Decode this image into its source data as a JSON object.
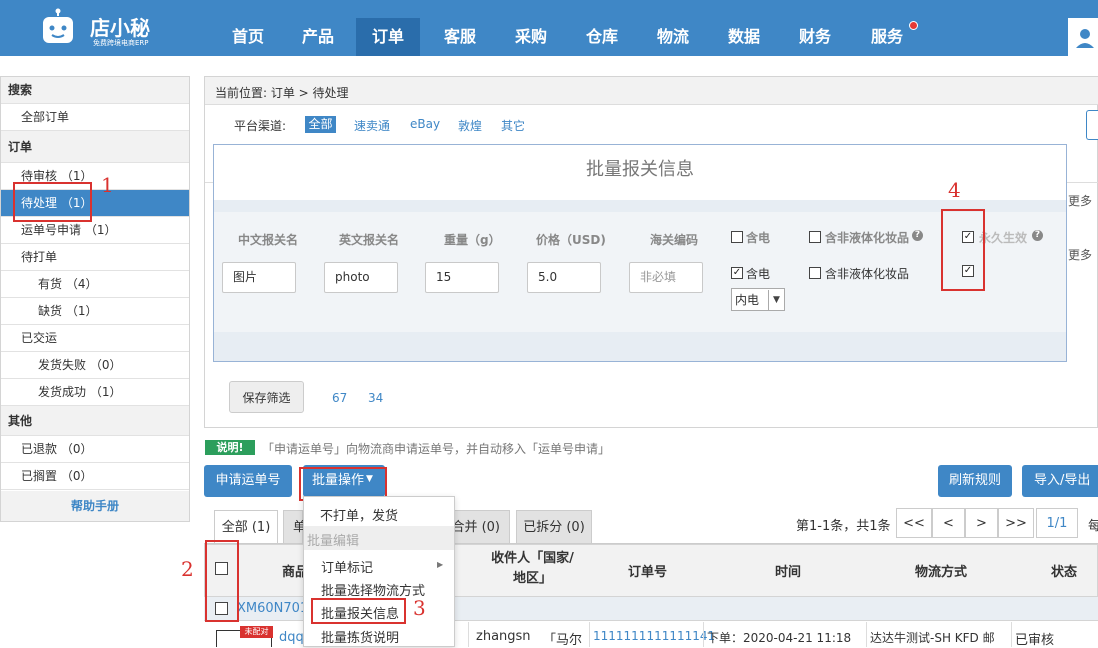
{
  "brand": {
    "name": "店小秘",
    "tagline": "免费跨境电商ERP"
  },
  "nav": [
    "首页",
    "产品",
    "订单",
    "客服",
    "采购",
    "仓库",
    "物流",
    "数据",
    "财务",
    "服务"
  ],
  "sidebar": {
    "search_head": "搜索",
    "all_orders": "全部订单",
    "order_head": "订单",
    "pending_review": "待审核 （1）",
    "to_process": "待处理 （1）",
    "waybill_apply": "运单号申请 （1）",
    "to_print": "待打单",
    "in_stock": "有货 （4）",
    "out_of_stock": "缺货 （1）",
    "shipped": "已交运",
    "ship_failed": "发货失败 （0）",
    "ship_success": "发货成功 （1）",
    "other_head": "其他",
    "refunded": "已退款 （0）",
    "on_hold": "已搁置 （0）",
    "help": "帮助手册"
  },
  "breadcrumb": "当前位置:  订单 > 待处理",
  "platform": {
    "label": "平台渠道:",
    "options": [
      "全部",
      "速卖通",
      "eBay",
      "敦煌",
      "其它"
    ]
  },
  "right_peek": {
    "more1": "更多",
    "more2": "更多"
  },
  "modal": {
    "title": "批量报关信息",
    "headers": {
      "cn_name": "中文报关名",
      "en_name": "英文报关名",
      "weight": "重量（g）",
      "price": "价格（USD)",
      "hs_code": "海关编码",
      "battery": "含电",
      "liquid": "含非液体化妆品",
      "permanent": "永久生效"
    },
    "values": {
      "cn_name": "图片",
      "en_name": "photo",
      "weight": "15",
      "price": "5.0",
      "hs_code_placeholder": "非必填",
      "battery": "含电",
      "battery_type": "内电",
      "liquid": "含非液体化妆品"
    }
  },
  "annotations": [
    "1",
    "2",
    "3",
    "4"
  ],
  "filters": {
    "save": "保存筛选",
    "saved": [
      "67",
      "34"
    ]
  },
  "notice": {
    "badge": "说明!",
    "text": "「申请运单号」向物流商申请运单号，并自动移入「运单号申请」"
  },
  "toolbar": {
    "apply_waybill": "申请运单号",
    "batch_ops": "批量操作",
    "refresh_rules": "刷新规则",
    "import_export": "导入/导出"
  },
  "dropdown": {
    "no_print_ship": "不打单，发货",
    "batch_edit_head": "批量编辑",
    "order_mark": "订单标记",
    "batch_logistics": "批量选择物流方式",
    "batch_customs": "批量报关信息",
    "batch_picking": "批量拣货说明"
  },
  "tabs": {
    "all": "全部 (1)",
    "single": "单",
    "merge": "合并 (0)",
    "split": "已拆分 (0)"
  },
  "pagination": {
    "summary": "第1-1条，共1条",
    "first": "<<",
    "prev": "<",
    "next": ">",
    "last": ">>",
    "page": "1/1",
    "per": "每"
  },
  "table": {
    "headers": {
      "product": "商品",
      "recipient": "收件人「国家/地区」",
      "order_no": "订单号",
      "time": "时间",
      "shipping": "物流方式",
      "status": "状态"
    },
    "group_id": "XM60N7017",
    "row": {
      "badge": "未配对",
      "product": "dqq",
      "recipient": "zhangsn",
      "country": "「马尔",
      "order_no": "1111111111111141",
      "time": "下单：2020-04-21 11:18",
      "shipping": "达达牛测试-SH KFD 邮",
      "status": "已审核"
    }
  }
}
